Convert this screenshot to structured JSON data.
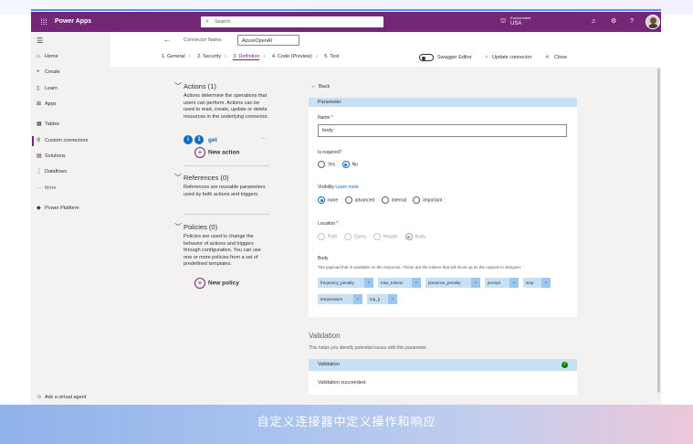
{
  "topbar": {
    "app_name": "Power Apps",
    "search_placeholder": "Search",
    "env_label": "Environment",
    "env_value": "USA"
  },
  "sidebar": {
    "items": [
      {
        "label": "Home",
        "icon": "home-icon",
        "glyph": "⌂"
      },
      {
        "label": "Create",
        "icon": "plus-icon",
        "glyph": "+"
      },
      {
        "label": "Learn",
        "icon": "book-icon",
        "glyph": "▯"
      },
      {
        "label": "Apps",
        "icon": "apps-icon",
        "glyph": "⊞"
      },
      {
        "label": "Tables",
        "icon": "table-icon",
        "glyph": "▦"
      },
      {
        "label": "Custom connectors",
        "icon": "connector-icon",
        "glyph": "⚲"
      },
      {
        "label": "Solutions",
        "icon": "solutions-icon",
        "glyph": "▤"
      },
      {
        "label": "Dataflows",
        "icon": "dataflow-icon",
        "glyph": "⋮"
      },
      {
        "label": "More",
        "icon": "more-icon",
        "glyph": "···"
      },
      {
        "label": "Power Platform",
        "icon": "power-platform-icon",
        "glyph": "◆"
      }
    ],
    "virtual_agent": "Ask a virtual agent"
  },
  "command": {
    "connector_name_label": "Connector Name",
    "connector_name_value": "AzureOpenAI",
    "steps": [
      "1. General",
      "2. Security",
      "3. Definition",
      "4. Code (Preview)",
      "5. Test"
    ],
    "active_step": "3. Definition",
    "swagger": "Swagger Editor",
    "update": "Update connector",
    "close": "Close"
  },
  "definition": {
    "actions_title": "Actions (1)",
    "actions_desc": "Actions determine the operations that users can perform. Actions can be used to read, create, update or delete resources in the underlying connector.",
    "action_badge": "1",
    "action_name": "get",
    "action_more": "···",
    "new_action": "New action",
    "references_title": "References (0)",
    "references_desc": "References are reusable parameters used by both actions and triggers.",
    "policies_title": "Policies (0)",
    "policies_desc": "Policies are used to change the behavior of actions and triggers through configuration. You can use one or more policies from a set of predefined templates.",
    "new_policy": "New policy"
  },
  "parameter": {
    "back": "Back",
    "header": "Parameter",
    "name_label": "Name",
    "name_value": "body",
    "required_label": "Is required?",
    "required_options": [
      "Yes",
      "No"
    ],
    "required_selected": "No",
    "visibility_label": "Visibility",
    "visibility_link": "Learn more",
    "visibility_options": [
      "none",
      "advanced",
      "internal",
      "important"
    ],
    "visibility_selected": "none",
    "location_label": "Location",
    "location_options": [
      "Path",
      "Query",
      "Header",
      "Body"
    ],
    "location_selected": "Body",
    "body_label": "Body",
    "body_desc": "The payload that is available on the response. These are the tokens that will show up as the outputs in designer.",
    "chips": [
      "frequency_penalty",
      "max_tokens",
      "presence_penalty",
      "prompt",
      "stop",
      "temperature",
      "top_p"
    ]
  },
  "validation": {
    "title": "Validation",
    "desc": "This helps you identify potential issues with this parameter.",
    "bar": "Validation",
    "result": "Validation succeeded."
  },
  "caption": "自定义连接器中定义操作和响应",
  "colors": {
    "brand": "#742774",
    "accent": "#0f6cbd",
    "header_blue": "#c7e0f4",
    "success": "#107c10"
  }
}
